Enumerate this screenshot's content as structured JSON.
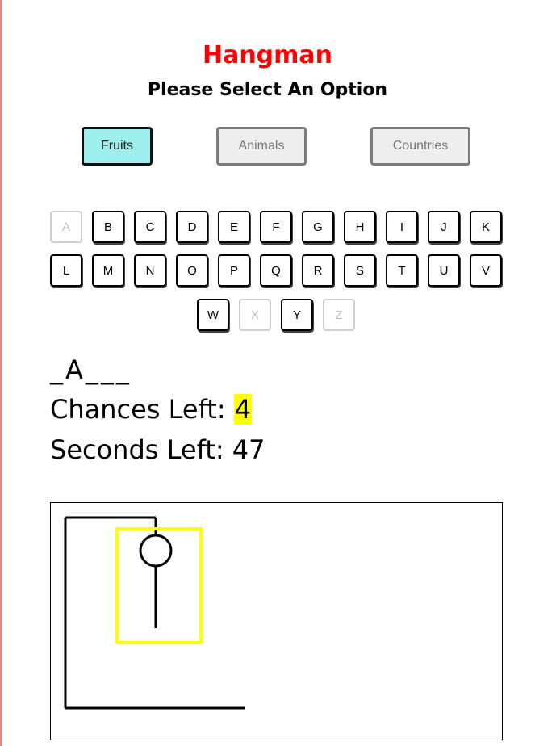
{
  "title": "Hangman",
  "prompt": "Please Select An Option",
  "categories": [
    {
      "label": "Fruits",
      "active": true
    },
    {
      "label": "Animals",
      "active": false
    },
    {
      "label": "Countries",
      "active": false
    }
  ],
  "keyboard": {
    "rows": [
      [
        "A",
        "B",
        "C",
        "D",
        "E",
        "F",
        "G",
        "H",
        "I",
        "J",
        "K"
      ],
      [
        "L",
        "M",
        "N",
        "O",
        "P",
        "Q",
        "R",
        "S",
        "T",
        "U",
        "V"
      ],
      [
        "W",
        "X",
        "Y",
        "Z"
      ]
    ],
    "used_letters": [
      "A",
      "X",
      "Z"
    ]
  },
  "word_display": "_A___",
  "chances": {
    "label": "Chances Left: ",
    "value": "4"
  },
  "seconds": {
    "label": "Seconds Left: ",
    "value": "47"
  },
  "drawing": {
    "parts_shown": [
      "gallows",
      "rope",
      "head",
      "body"
    ],
    "highlight_color": "#ffff00"
  },
  "colors": {
    "title": "#ff0000",
    "active_option": "#9cefec",
    "highlight": "#ffff00"
  }
}
